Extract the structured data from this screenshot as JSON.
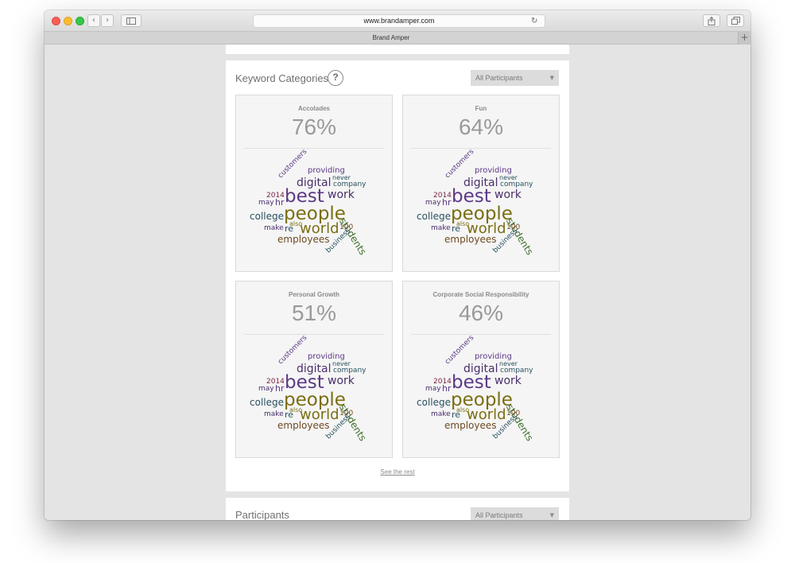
{
  "browser": {
    "url": "www.brandamper.com",
    "tab_title": "Brand Amper",
    "nav_back": "‹",
    "nav_forward": "›",
    "new_tab": "+"
  },
  "keyword_section": {
    "title": "Keyword Categories",
    "help": "?",
    "filter": "All Participants",
    "see_rest": "See the rest",
    "panels": [
      {
        "title": "Accolades",
        "value": "76%"
      },
      {
        "title": "Fun",
        "value": "64%"
      },
      {
        "title": "Personal Growth",
        "value": "51%"
      },
      {
        "title": "Corporate Social Responsibility",
        "value": "46%"
      }
    ],
    "words": {
      "customers": "customers",
      "providing": "providing",
      "digital": "digital",
      "never": "never",
      "company": "company",
      "y2014": "2014",
      "may": "may",
      "hr": "hr",
      "best": "best",
      "work": "work",
      "college": "college",
      "people": "people",
      "students": "students",
      "also": "also",
      "make": "make",
      "re": "re",
      "world": "world",
      "n100": "100",
      "employees": "employees",
      "business": "business"
    }
  },
  "participants_section": {
    "title": "Participants",
    "filter": "All Participants"
  },
  "colors": {
    "purple": "#5c3a86",
    "darkpurple": "#4a2f6a",
    "olive": "#7a6e12",
    "green": "#3e6e2a",
    "teal": "#28505e",
    "brown": "#6e4a22",
    "maroon": "#7a2445"
  }
}
